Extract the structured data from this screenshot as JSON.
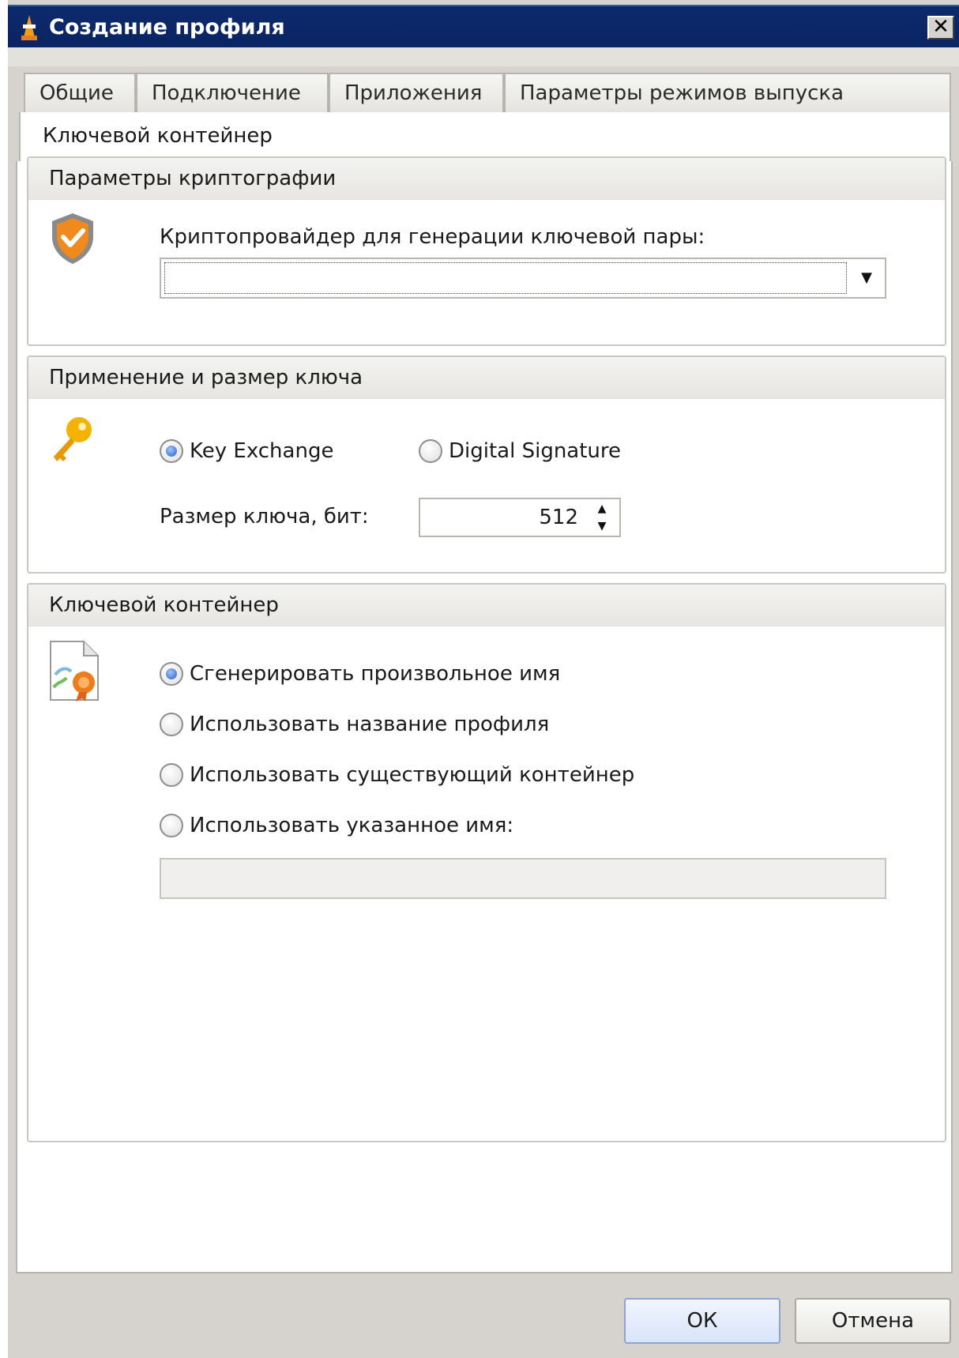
{
  "window": {
    "title": "Создание профиля",
    "close_glyph": "✕"
  },
  "tabs": {
    "items": [
      {
        "label": "Общие"
      },
      {
        "label": "Подключение"
      },
      {
        "label": "Приложения"
      },
      {
        "label": "Параметры режимов выпуска"
      }
    ],
    "active_label": "Ключевой контейнер"
  },
  "crypto_group": {
    "title": "Параметры криптографии",
    "icon": "shield-check-icon",
    "provider_label": "Криптопровайдер для генерации ключевой пары:",
    "provider_value": "",
    "dropdown_glyph": "▼"
  },
  "key_group": {
    "title": "Применение и размер ключа",
    "icon": "key-icon",
    "options": [
      {
        "label": "Key Exchange",
        "checked": true
      },
      {
        "label": "Digital Signature",
        "checked": false
      }
    ],
    "size_label": "Размер ключа, бит:",
    "size_value": "512",
    "spin_up_glyph": "▲",
    "spin_down_glyph": "▼"
  },
  "container_group": {
    "title": "Ключевой контейнер",
    "icon": "certificate-document-icon",
    "options": [
      {
        "label": "Сгенерировать произвольное имя",
        "checked": true
      },
      {
        "label": "Использовать название профиля",
        "checked": false
      },
      {
        "label": "Использовать существующий контейнер",
        "checked": false
      },
      {
        "label": "Использовать указанное имя:",
        "checked": false
      }
    ],
    "name_value": ""
  },
  "buttons": {
    "ok": "ОК",
    "cancel": "Отмена"
  },
  "colors": {
    "titlebar": "#0a2463",
    "window_bg": "#d6d3ce",
    "shield": "#f08a1c",
    "key": "#f6b200",
    "radio_checked": "#2a5fc7"
  }
}
